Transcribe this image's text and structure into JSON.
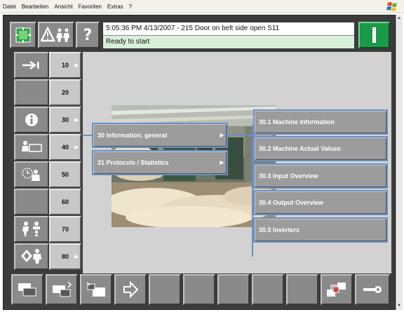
{
  "browser_menu": [
    "Datei",
    "Bearbeiten",
    "Ansicht",
    "Favoriten",
    "Extras",
    "?"
  ],
  "header": {
    "status_line1": "5:05:36 PM  4/13/2007    - 215 Door on belt side open S11",
    "status_line2": "Ready to start",
    "help_label": "?"
  },
  "nav": [
    {
      "num": "10",
      "icon": "arrow-right-icon",
      "arrow": true
    },
    {
      "num": "20",
      "icon": "",
      "arrow": false
    },
    {
      "num": "30",
      "icon": "info-icon",
      "arrow": true
    },
    {
      "num": "40",
      "icon": "operator-screen-icon",
      "arrow": true
    },
    {
      "num": "50",
      "icon": "clock-operator-icon",
      "arrow": false
    },
    {
      "num": "60",
      "icon": "",
      "arrow": false
    },
    {
      "num": "70",
      "icon": "maintenance-people-icon",
      "arrow": false
    },
    {
      "num": "80",
      "icon": "service-operator-icon",
      "arrow": true
    }
  ],
  "submenu": [
    {
      "label": "30 Information, general",
      "arrow": true
    },
    {
      "label": "31 Protocols / Statistics",
      "arrow": true
    }
  ],
  "submenu_l3": [
    "30.1  Machine Information",
    "30.2  Machine Actual Values",
    "30.3  Input Overview",
    "30.4  Output Overview",
    "30.5  Inverters"
  ],
  "colors": {
    "frame": "#3c3c3c",
    "button": "#8a8a8a",
    "content_bg": "#d2d2d2",
    "start_green": "#1a9a48",
    "highlight_blue": "#6b8fc4",
    "status_green": "#d8f0d8"
  }
}
